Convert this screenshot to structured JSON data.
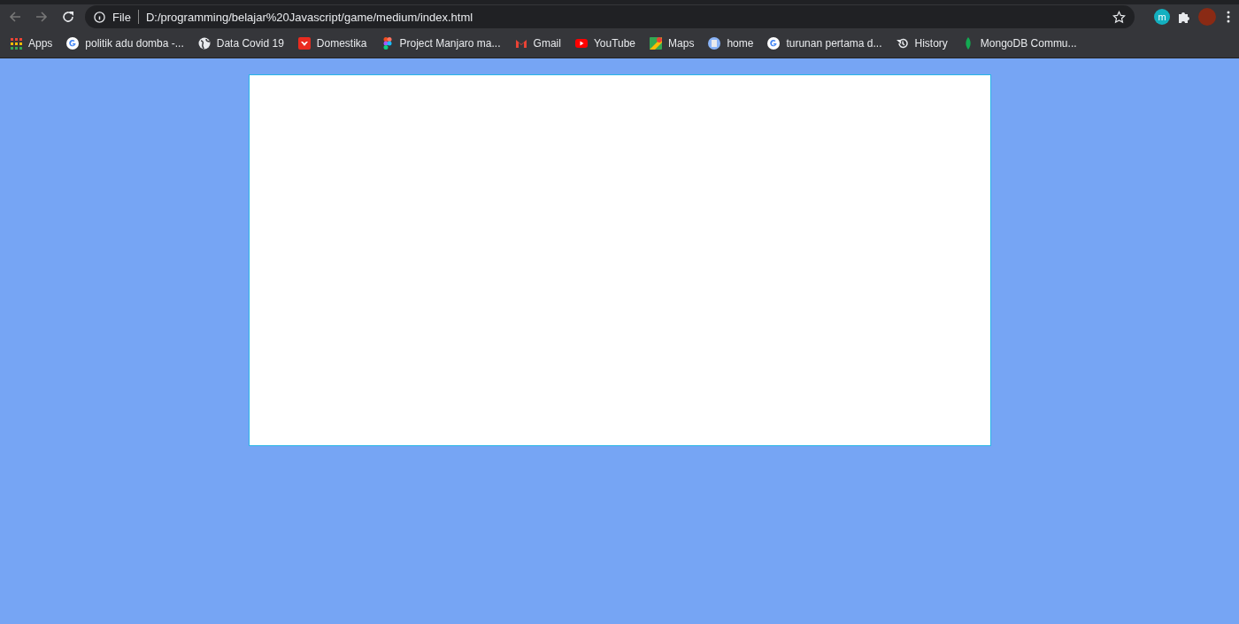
{
  "toolbar": {
    "security_label": "File",
    "url": "D:/programming/belajar%20Javascript/game/medium/index.html",
    "extension_letter": "m"
  },
  "bookmarks": [
    {
      "label": "Apps",
      "kind": "apps"
    },
    {
      "label": "politik adu domba -...",
      "kind": "google"
    },
    {
      "label": "Data Covid 19",
      "kind": "globe"
    },
    {
      "label": "Domestika",
      "kind": "domestika"
    },
    {
      "label": "Project Manjaro ma...",
      "kind": "figma"
    },
    {
      "label": "Gmail",
      "kind": "gmail"
    },
    {
      "label": "YouTube",
      "kind": "youtube"
    },
    {
      "label": "Maps",
      "kind": "maps"
    },
    {
      "label": "home",
      "kind": "doc"
    },
    {
      "label": "turunan pertama d...",
      "kind": "google"
    },
    {
      "label": "History",
      "kind": "history"
    },
    {
      "label": "MongoDB Commu...",
      "kind": "mongodb"
    }
  ]
}
